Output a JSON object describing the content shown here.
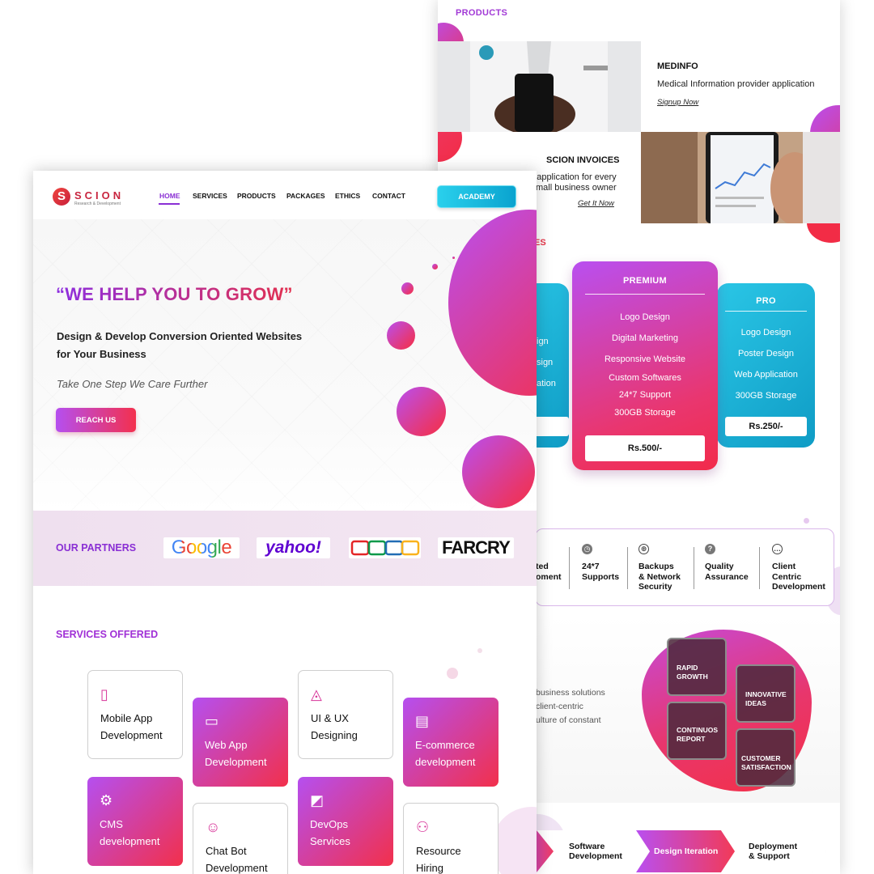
{
  "back": {
    "products_title": "PRODUCTS",
    "product1": {
      "name": "MEDINFO",
      "desc": "Medical Information provider application",
      "link": "Signup Now"
    },
    "product2": {
      "name": "SCION INVOICES",
      "desc1": "application for every",
      "desc2": "mall business owner",
      "link": "Get It Now"
    },
    "packages_title": "ES",
    "left_card": {
      "f1": "ign",
      "f2": "sign",
      "f3": "ation",
      "price": "/-"
    },
    "premium": {
      "title": "PREMIUM",
      "features": [
        "Logo Design",
        "Digital Marketing",
        "Responsive Website",
        "Custom Softwares",
        "24*7 Support",
        "300GB Storage"
      ],
      "price": "Rs.500/-"
    },
    "pro": {
      "title": "PRO",
      "features": [
        "Logo Design",
        "Poster Design",
        "Web Application",
        "300GB Storage"
      ],
      "price": "Rs.250/-"
    },
    "features": [
      {
        "l1": "ted",
        "l2": "oment",
        "l3": ""
      },
      {
        "l1": "24*7",
        "l2": "Supports",
        "l3": ""
      },
      {
        "l1": "Backups",
        "l2": "& Network",
        "l3": "Security"
      },
      {
        "l1": "Quality",
        "l2": "Assurance",
        "l3": ""
      },
      {
        "l1": "Client",
        "l2": "Centric",
        "l3": "Development"
      }
    ],
    "about": {
      "l1": "business solutions",
      "l2": "client-centric",
      "l3": "ulture of constant"
    },
    "tiles": {
      "rapid1": "RAPID",
      "rapid2": "GROWTH",
      "innov1": "INNOVATIVE",
      "innov2": "IDEAS",
      "cont1": "CONTINUOS",
      "cont2": "REPORT",
      "cust1": "CUSTOMER",
      "cust2": "SATISFACTION"
    },
    "steps": [
      {
        "l1": "Software",
        "l2": "Development"
      },
      {
        "l1": "Design Iteration",
        "l2": ""
      },
      {
        "l1": "Deployment",
        "l2": "& Support"
      }
    ]
  },
  "front": {
    "logo": {
      "name": "SCION",
      "sub": "Research & Development"
    },
    "nav": {
      "home": "HOME",
      "services": "SERVICES",
      "products": "PRODUCTS",
      "packages": "PACKAGES",
      "ethics": "ETHICS",
      "contact": "CONTACT"
    },
    "academy": "ACADEMY",
    "hero": {
      "title": "“WE HELP YOU TO GROW”",
      "sub1": "Design & Develop  Conversion Oriented Websites",
      "sub2": "for Your Business",
      "tagline": "Take One Step We Care Further",
      "cta": "REACH US"
    },
    "partners": {
      "title": "OUR PARTNERS",
      "google": "Google",
      "yahoo": "yahoo!",
      "farcry": "FARCRY"
    },
    "services": {
      "title": "SERVICES OFFERED",
      "items": [
        {
          "l1": "Mobile App",
          "l2": "Development"
        },
        {
          "l1": "Web App",
          "l2": "Development"
        },
        {
          "l1": "UI & UX",
          "l2": "Designing"
        },
        {
          "l1": "E-commerce",
          "l2": "development"
        },
        {
          "l1": "CMS",
          "l2": "development"
        },
        {
          "l1": "Chat Bot",
          "l2": "Development"
        },
        {
          "l1": "DevOps",
          "l2": "Services"
        },
        {
          "l1": "Resource",
          "l2": "Hiring"
        }
      ]
    }
  },
  "colors": {
    "purple": "#8a2fd4",
    "pink": "#f2304b",
    "cyan": "#0fa6d0"
  }
}
